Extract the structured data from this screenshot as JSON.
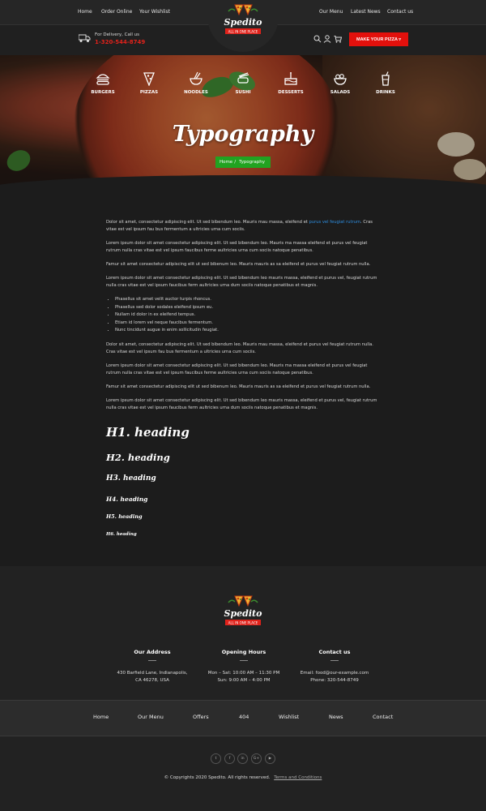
{
  "topnav": {
    "left": [
      "Home",
      "Order Online",
      "Your Wishlist"
    ],
    "right": [
      "Our Menu",
      "Latest News",
      "Contact us"
    ]
  },
  "brand": {
    "name": "Spedito",
    "tagline": "ALL IN ONE PLACE"
  },
  "header": {
    "delivery_label": "For Delivery, Call us",
    "delivery_phone": "1-320-544-8749",
    "cta_label": "MAKE YOUR PIZZA"
  },
  "categories": [
    {
      "label": "BURGERS",
      "icon": "burger-icon"
    },
    {
      "label": "PIZZAS",
      "icon": "pizza-slice-icon"
    },
    {
      "label": "NOODLES",
      "icon": "noodle-bowl-icon"
    },
    {
      "label": "SUSHI",
      "icon": "sushi-icon"
    },
    {
      "label": "DESSERTS",
      "icon": "cake-icon"
    },
    {
      "label": "SALADS",
      "icon": "salad-bowl-icon"
    },
    {
      "label": "DRINKS",
      "icon": "drink-glass-icon"
    }
  ],
  "hero": {
    "title": "Typography",
    "breadcrumb": {
      "home": "Home",
      "separator": "/",
      "current": "Typography"
    }
  },
  "content": {
    "p1_before": "Dolor sit amet, consectetur adipiscing elit. Ut sed bibendum leo. Mauris mau massa, eleifend et",
    "p1_link": "purus vel feugiat rutrum",
    "p1_after": ". Cras vitae est vel ipsum fau bus fermentum a ultricies urna cum sociis.",
    "p2": "Lorem ipsum dolor sit amet consectetur adipiscing elit. Ut sed bibendum leo. Mauris ma massa eleifend et purus vel feugiat rutrum nulla cras vitae est vel ipsum faucibus ferme aultricies urna cum sociis natoque penatibus.",
    "p3": "Famur sit amet consectetur adipiscing elit ut sed bibenum leo. Mauris mauris as sa eleifend et purus vel feugiat rutrum nulla.",
    "p4": "Lorem ipsum dolor sit amet consectetur adipiscing elit. Ut sed bibendum leo mauris massa, eleifend et purus vel, feugiat rutrum nulla cras vitae est vel ipsum faucibus ferm aultricies urna dum sociis natoque penatibus et magnis.",
    "list": [
      "Phasellus sit amet velit auctor turpis rhoncus.",
      "Phasellus sed dolor sodales eleifend ipsum eu.",
      "Nullam id dolor in ex eleifend tempus.",
      "Etiam id lorem vel neque faucibus fermentum.",
      "Nunc tincidunt augue in enim sollicitudin feugiat."
    ],
    "p5": "Dolor sit amet, consectetur adipiscing elit. Ut sed bibendum leo. Mauris mau massa, eleifend et purus vel feugiat rutrum nulla. Cras vitae est vel ipsum fau bus fermentum a ultricies urna cum sociis.",
    "p6": "Lorem ipsum dolor sit amet consectetur adipiscing elit. Ut sed bibendum leo. Mauris ma massa eleifend et purus vel feugiat rutrum nulla cras vitae est vel ipsum faucibus ferme aultricies urna cum sociis natoque penatibus.",
    "p7": "Famur sit amet consectetur adipiscing elit ut sed bibenum leo. Mauris mauris as sa eleifend et purus vel feugiat rutrum nulla.",
    "p8": "Lorem ipsum dolor sit amet consectetur adipiscing elit. Ut sed bibendum leo mauris massa, eleifend et purus vel, feugiat rutrum nulla cras vitae est vel ipsum faucibus ferm aultricies urna dum sociis natoque penatibus et magnis.",
    "headings": [
      "H1. heading",
      "H2. heading",
      "H3. heading",
      "H4. heading",
      "H5. heading",
      "H6. heading"
    ]
  },
  "footer": {
    "address": {
      "title": "Our Address",
      "lines": [
        "430 Barfield Lane, Indianapolis,",
        "CA 46278, USA"
      ]
    },
    "hours": {
      "title": "Opening Hours",
      "lines": [
        "Mon – Sat: 10:00 AM – 11:30 PM",
        "Sun: 9:00 AM – 4:00 PM"
      ]
    },
    "contact": {
      "title": "Contact us",
      "lines": [
        "Email: food@our-example.com",
        "Phone: 320-544-8749"
      ]
    },
    "nav": [
      "Home",
      "Our Menu",
      "Offers",
      "404",
      "Wishlist",
      "News",
      "Contact"
    ],
    "social": [
      {
        "icon": "twitter-icon",
        "glyph": "t"
      },
      {
        "icon": "facebook-icon",
        "glyph": "f"
      },
      {
        "icon": "linkedin-icon",
        "glyph": "in"
      },
      {
        "icon": "google-plus-icon",
        "glyph": "G+"
      },
      {
        "icon": "youtube-icon",
        "glyph": "▶"
      }
    ],
    "copyright": "© Copyrights 2020 Spedito. All rights reserved.",
    "terms": "Terms and Conditions"
  },
  "colors": {
    "accent_red": "#e3100c",
    "breadcrumb_green": "#21a321",
    "link_blue": "#2d8ee0",
    "background": "#1c1c1c"
  }
}
